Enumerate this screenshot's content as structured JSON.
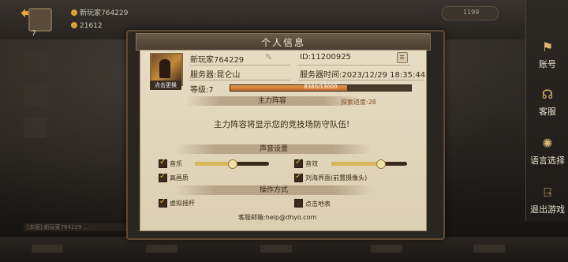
{
  "background_ui": {
    "player_name": "新玩家764229",
    "coins": "21612",
    "level_mini": "7",
    "top_right": "1199",
    "chat_text": "[本服] 新玩家764229 ..."
  },
  "right_panel": {
    "account_label": "账号",
    "service_label": "客服",
    "language_label": "语言选择",
    "exit_label": "退出游戏"
  },
  "dialog": {
    "title": "个人信息",
    "player_name": "新玩家764229",
    "id_text": "ID:11200925",
    "server_text": "服务器:昆仑山",
    "server_time_text": "服务器时间:2023/12/29 18:35:44",
    "level_text": "等级:7",
    "xp_text": "8380/13000",
    "xp_fraction": 0.645,
    "swap_label": "点击更换",
    "lineup_section": "主力阵容",
    "explore_progress": "探索进度:28",
    "lineup_message": "主力阵容将显示您的竞技场防守队伍!",
    "sound_section": "声音设置",
    "music_label": "音乐",
    "music_level": 0.5,
    "sfx_label": "音效",
    "sfx_level": 0.65,
    "hd_label": "高画质",
    "notch_label": "刘海界面(前置摄像头)",
    "control_section": "操作方式",
    "joystick_label": "虚拟摇杆",
    "tap_ground_label": "点击地表",
    "support_email": "客服邮箱:help@dhyo.com"
  },
  "colors": {
    "accent": "#e6a33a",
    "paper": "#e7dcc4",
    "xp": "#d87a3a"
  }
}
